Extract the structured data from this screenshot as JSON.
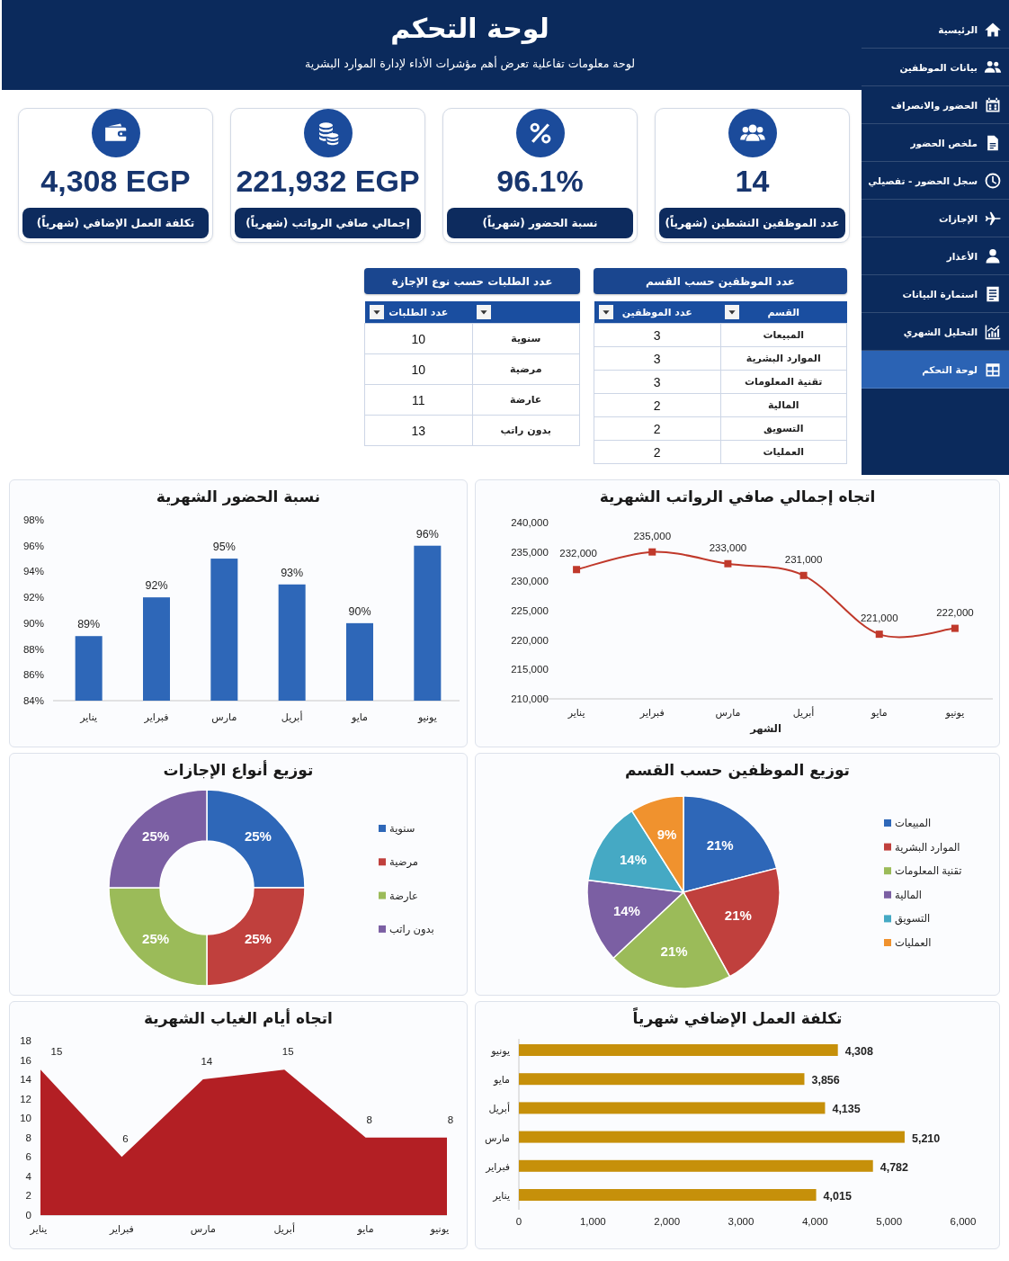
{
  "sidebar": {
    "items": [
      {
        "label": "الرئيسية",
        "selected": false
      },
      {
        "label": "بيانات الموظفين",
        "selected": false
      },
      {
        "label": "الحضور والانصراف",
        "selected": false
      },
      {
        "label": "ملخص الحضور",
        "selected": false
      },
      {
        "label": "سجل الحضور - تفصيلي",
        "selected": false
      },
      {
        "label": "الإجازات",
        "selected": false
      },
      {
        "label": "الأعذار",
        "selected": false
      },
      {
        "label": "استمارة البيانات",
        "selected": false
      },
      {
        "label": "التحليل الشهري",
        "selected": false
      },
      {
        "label": "لوحة التحكم",
        "selected": true
      }
    ]
  },
  "header": {
    "title": "لوحة التحكم",
    "subtitle": "لوحة معلومات تفاعلية تعرض أهم مؤشرات الأداء لإدارة الموارد البشرية"
  },
  "kpis": [
    {
      "value": "14",
      "label": "عدد الموظفين النشطين (شهرياً)"
    },
    {
      "value": "96.1%",
      "label": "نسبة الحضور (شهرياً)"
    },
    {
      "value": "221,932 EGP",
      "label": "إجمالي صافي الرواتب (شهرياً)"
    },
    {
      "value": "4,308 EGP",
      "label": "تكلفة العمل الإضافي (شهرياً)"
    }
  ],
  "tables": [
    {
      "title": "عدد الموظفين حسب القسم",
      "columns": [
        {
          "kind": "heading",
          "label": "القسم"
        },
        {
          "kind": "heading",
          "label": "عدد الموظفين"
        }
      ],
      "rows": [
        [
          "المبيعات",
          "3"
        ],
        [
          "الموارد البشرية",
          "3"
        ],
        [
          "تقنية المعلومات",
          "3"
        ],
        [
          "المالية",
          "2"
        ],
        [
          "التسويق",
          "2"
        ],
        [
          "العمليات",
          "2"
        ]
      ]
    },
    {
      "title": "عدد الطلبات حسب نوع الإجازة",
      "columns": [
        {
          "kind": "blank"
        },
        {
          "kind": "heading",
          "label": "عدد الطلبات"
        }
      ],
      "rows": [
        [
          "سنوية",
          "10"
        ],
        [
          "مرضية",
          "10"
        ],
        [
          "عارضة",
          "11"
        ],
        [
          "بدون راتب",
          "13"
        ]
      ]
    }
  ],
  "charts": [
    {
      "chart_data": {
        "type": "line",
        "title": "اتجاه إجمالي صافي الرواتب الشهرية",
        "xlabel": "الشهر",
        "categories": [
          "يناير",
          "فبراير",
          "مارس",
          "أبريل",
          "مايو",
          "يونيو"
        ],
        "series": [
          {
            "color": "#c0392b",
            "marker": "square",
            "values": [
              232000,
              235000,
              233000,
              231000,
              221000,
              222000
            ]
          }
        ],
        "ylim": [
          210000,
          240000
        ],
        "yticks": [
          {
            "value": 210000,
            "label": "210,000"
          },
          {
            "value": 215000,
            "label": "215,000"
          },
          {
            "value": 220000,
            "label": "220,000"
          },
          {
            "value": 225000,
            "label": "225,000"
          },
          {
            "value": 230000,
            "label": "230,000"
          },
          {
            "value": 235000,
            "label": "235,000"
          },
          {
            "value": 240000,
            "label": "240,000"
          }
        ],
        "value_labels": [
          "232,000",
          "235,000",
          "233,000",
          "231,000",
          "221,000",
          "222,000"
        ]
      }
    },
    {
      "chart_data": {
        "type": "bar",
        "title": "نسبة الحضور الشهرية",
        "categories": [
          "يناير",
          "فبراير",
          "مارس",
          "أبريل",
          "مايو",
          "يونيو"
        ],
        "series": [
          {
            "color": "#2e67b8",
            "values": [
              89,
              92,
              95,
              93,
              90,
              96
            ]
          }
        ],
        "ylim": [
          84,
          98
        ],
        "yticks": [
          {
            "value": 84,
            "label": "84%"
          },
          {
            "value": 86,
            "label": "86%"
          },
          {
            "value": 88,
            "label": "88%"
          },
          {
            "value": 90,
            "label": "90%"
          },
          {
            "value": 92,
            "label": "92%"
          },
          {
            "value": 94,
            "label": "94%"
          },
          {
            "value": 96,
            "label": "96%"
          },
          {
            "value": 98,
            "label": "98%"
          }
        ],
        "value_labels": [
          "89%",
          "92%",
          "95%",
          "93%",
          "90%",
          "96%"
        ]
      }
    },
    {
      "chart_data": {
        "type": "pie",
        "title": "توزيع الموظفين حسب القسم",
        "categories": [
          "المبيعات",
          "الموارد البشرية",
          "تقنية المعلومات",
          "المالية",
          "التسويق",
          "العمليات"
        ],
        "legend": "right",
        "series": [
          {
            "colors": [
              "#2e67b8",
              "#c0403d",
              "#9bbb59",
              "#7b5fa3",
              "#45a9c4",
              "#f0922e"
            ],
            "values": [
              21,
              21,
              21,
              14,
              14,
              9
            ]
          }
        ],
        "value_labels": [
          "21%",
          "21%",
          "21%",
          "14%",
          "14%",
          "9%"
        ]
      }
    },
    {
      "chart_data": {
        "type": "donut",
        "title": "توزيع أنواع الإجازات",
        "categories": [
          "سنوية",
          "مرضية",
          "عارضة",
          "بدون راتب"
        ],
        "legend": "right",
        "series": [
          {
            "colors": [
              "#2e67b8",
              "#c0403d",
              "#9bbb59",
              "#7b5fa3"
            ],
            "values": [
              25,
              25,
              25,
              25
            ]
          }
        ],
        "value_labels": [
          "25%",
          "25%",
          "25%",
          "25%"
        ]
      }
    },
    {
      "chart_data": {
        "type": "bar",
        "orientation": "horizontal",
        "title": "تكلفة العمل الإضافي شهرياً",
        "categories": [
          "يونيو",
          "مايو",
          "أبريل",
          "مارس",
          "فبراير",
          "يناير"
        ],
        "series": [
          {
            "color": "#c6900a",
            "values": [
              4308,
              3856,
              4135,
              5210,
              4782,
              4015
            ]
          }
        ],
        "xlim": [
          0,
          6000
        ],
        "xticks": [
          {
            "value": 0,
            "label": "0"
          },
          {
            "value": 1000,
            "label": "1,000"
          },
          {
            "value": 2000,
            "label": "2,000"
          },
          {
            "value": 3000,
            "label": "3,000"
          },
          {
            "value": 4000,
            "label": "4,000"
          },
          {
            "value": 5000,
            "label": "5,000"
          },
          {
            "value": 6000,
            "label": "6,000"
          }
        ],
        "value_labels": [
          "4,308",
          "3,856",
          "4,135",
          "5,210",
          "4,782",
          "4,015"
        ]
      }
    },
    {
      "chart_data": {
        "type": "area",
        "title": "اتجاه أيام الغياب الشهرية",
        "categories": [
          "يناير",
          "فبراير",
          "مارس",
          "أبريل",
          "مايو",
          "يونيو"
        ],
        "series": [
          {
            "color": "#b31f24",
            "values": [
              15,
              6,
              14,
              15,
              8,
              8
            ]
          }
        ],
        "ylim": [
          0,
          18
        ],
        "yticks": [
          0,
          2,
          4,
          6,
          8,
          10,
          12,
          14,
          16,
          18
        ],
        "value_labels": [
          "15",
          "6",
          "14",
          "15",
          "8",
          "8"
        ]
      }
    }
  ]
}
